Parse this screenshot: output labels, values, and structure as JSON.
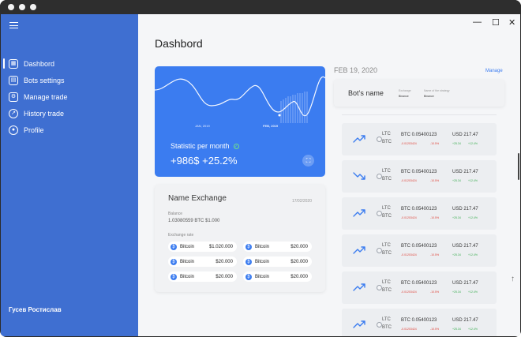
{
  "sidebar": {
    "items": [
      {
        "label": "Dashbord",
        "icon": "dashboard-icon",
        "active": true
      },
      {
        "label": "Bots settings",
        "icon": "bot-settings-icon",
        "active": false
      },
      {
        "label": "Manage trade",
        "icon": "manage-trade-icon",
        "active": false
      },
      {
        "label": "History trade",
        "icon": "history-trade-icon",
        "active": false
      },
      {
        "label": "Profile",
        "icon": "profile-icon",
        "active": false
      }
    ],
    "user_name": "Гусев Ростислав",
    "accent_color": "#3f6fd1"
  },
  "window_controls": {
    "close": "✕",
    "maximize": "☐",
    "minimize": "—"
  },
  "page": {
    "title": "Dashbord"
  },
  "statistic": {
    "label": "Statistic per month",
    "value": "+986$  +25.2%",
    "axis_labels": [
      "JAN, 2019",
      "FEB, 2019"
    ],
    "card_color": "#3b7cf0"
  },
  "exchange": {
    "title": "Name Exchange",
    "date": "17/02/2020",
    "balance_label": "Balance",
    "balance_value": "1.03080559 BTC   $1.000",
    "rate_label": "Exchange rate",
    "rates": [
      {
        "coin": "Bitcoin",
        "amount": "$1.020.000"
      },
      {
        "coin": "Bitcoin",
        "amount": "$20.000"
      },
      {
        "coin": "Bitcoin",
        "amount": "$20.000"
      },
      {
        "coin": "Bitcoin",
        "amount": "$20.000"
      },
      {
        "coin": "Bitcoin",
        "amount": "$20.000"
      },
      {
        "coin": "Bitcoin",
        "amount": "$20.000"
      }
    ]
  },
  "bots": {
    "date": "FEB 19, 2020",
    "manage_label": "Manage",
    "name": "Bot’s name",
    "exchange_label": "Exchange",
    "exchange_value": "Binance",
    "strategy_label": "Name of the strategy",
    "strategy_value": "Binance"
  },
  "trades": [
    {
      "trend": "up",
      "pair_top": "LTC",
      "pair_bottom": "BTC",
      "btc": "BTC 0.05400123",
      "btc_change": "-0.01203424",
      "btc_pct": "-10.5%",
      "usd": "USD 217.47",
      "usd_change": "+25.34",
      "usd_pct": "+12.4%"
    },
    {
      "trend": "down",
      "pair_top": "LTC",
      "pair_bottom": "BTC",
      "btc": "BTC 0.05400123",
      "btc_change": "-0.01203424",
      "btc_pct": "-10.5%",
      "usd": "USD 217.47",
      "usd_change": "+25.34",
      "usd_pct": "+12.4%"
    },
    {
      "trend": "up",
      "pair_top": "LTC",
      "pair_bottom": "BTC",
      "btc": "BTC 0.05400123",
      "btc_change": "-0.01203424",
      "btc_pct": "-10.5%",
      "usd": "USD 217.47",
      "usd_change": "+25.34",
      "usd_pct": "+12.4%"
    },
    {
      "trend": "up",
      "pair_top": "LTC",
      "pair_bottom": "BTC",
      "btc": "BTC 0.05400123",
      "btc_change": "-0.01203424",
      "btc_pct": "-10.5%",
      "usd": "USD 217.47",
      "usd_change": "+25.34",
      "usd_pct": "+12.4%"
    },
    {
      "trend": "up",
      "pair_top": "LTC",
      "pair_bottom": "BTC",
      "btc": "BTC 0.05400123",
      "btc_change": "-0.01203424",
      "btc_pct": "-10.5%",
      "usd": "USD 217.47",
      "usd_change": "+25.34",
      "usd_pct": "+12.4%"
    },
    {
      "trend": "up",
      "pair_top": "LTC",
      "pair_bottom": "BTC",
      "btc": "BTC 0.05400123",
      "btc_change": "-0.01203424",
      "btc_pct": "-10.5%",
      "usd": "USD 217.47",
      "usd_change": "+25.34",
      "usd_pct": "+12.4%"
    }
  ],
  "colors": {
    "negative": "#e0463c",
    "positive": "#3cae52",
    "primary": "#3b7cf0"
  }
}
